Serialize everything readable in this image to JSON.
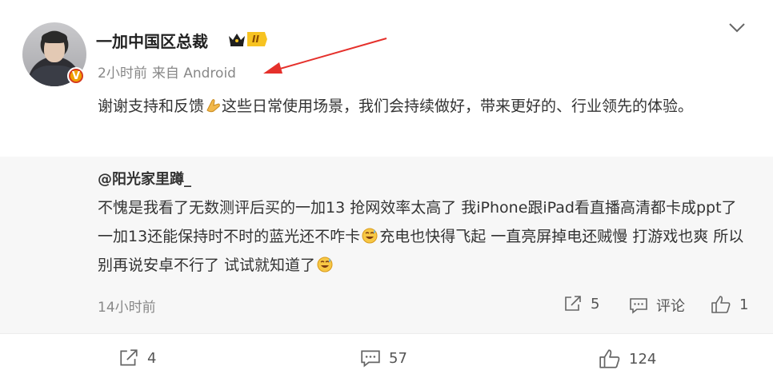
{
  "post": {
    "username": "一加中国区总裁",
    "level": "II",
    "time": "2小时前",
    "source": "来自 Android",
    "text_line1": "谢谢支持和反馈",
    "text_rest": "这些日常使用场景，我们会持续做好，带来更好的、行业领先的体验。",
    "verify_badge": "V"
  },
  "quoted": {
    "username": "@阳光家里蹲_",
    "seg1": "不愧是我看了无数测评后买的一加13 抢网效率太高了 我iPhone跟iPad看直播高清都卡成ppt了 一加13还能保持时不时的蓝光还不咋卡",
    "seg2": "充电也快得飞起 一直亮屏掉电还贼慢 打游戏也爽 所以别再说安卓不行了 试试就知道了",
    "time": "14小时前",
    "repost_count": "5",
    "comment_label": "评论",
    "like_count": "1"
  },
  "footer": {
    "repost_count": "4",
    "comment_count": "57",
    "like_count": "124"
  },
  "colors": {
    "arrow": "#e5302b",
    "meta_text": "#888888",
    "quote_bg": "#f7f7f7",
    "level_tag": "#f7c321"
  },
  "icons": [
    "chevron-down-icon",
    "crown-icon",
    "verified-badge-icon",
    "folded-hands-emoji",
    "smiling-sweat-emoji",
    "repost-icon",
    "comment-icon",
    "like-icon"
  ]
}
